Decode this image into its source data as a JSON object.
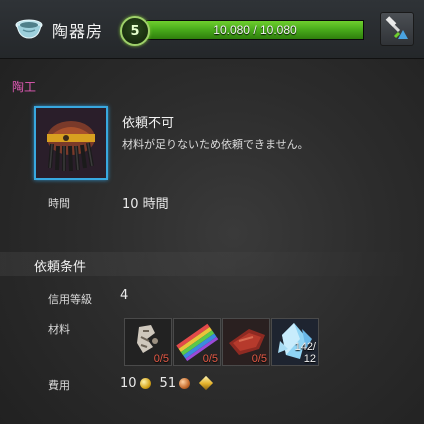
{
  "header": {
    "title": "陶器房",
    "level": "5",
    "xp_text": "10.080 / 10.080",
    "xp_fraction": 1.0,
    "app_icon": "pottery-bowl-icon",
    "action_icon": "hammer-icon"
  },
  "category": "陶工",
  "item": {
    "icon": "pottery-cap-icon",
    "status_title": "依頼不可",
    "status_message": "材料が足りないため依頼できません。"
  },
  "time": {
    "label": "時間",
    "value": "10 時間"
  },
  "requirements": {
    "section_title": "依頼条件",
    "trust": {
      "label": "信用等級",
      "value": "4"
    },
    "materials_label": "材料",
    "materials": [
      {
        "icon": "shell-fragment-icon",
        "qty": "0/5",
        "qty_color": "#e65a46"
      },
      {
        "icon": "rainbow-slate-icon",
        "qty": "0/5",
        "qty_color": "#e65a46"
      },
      {
        "icon": "red-clay-icon",
        "qty": "0/5",
        "qty_color": "#e65a46"
      },
      {
        "icon": "ice-crystal-icon",
        "qty_top": "142/",
        "qty_bottom": "12",
        "qty_color": "#f0f0f0"
      }
    ],
    "cost": {
      "label": "費用",
      "gold": "10",
      "silver": "51",
      "gold_icon": "gold-coin-icon",
      "silver_icon": "silver-coin-icon",
      "extra_icon": "currency-diamond-icon"
    }
  },
  "colors": {
    "accent_frame": "#38a8e0",
    "category": "#e45ab8",
    "xp_green": "#47a91a",
    "insufficient": "#e65a46"
  }
}
